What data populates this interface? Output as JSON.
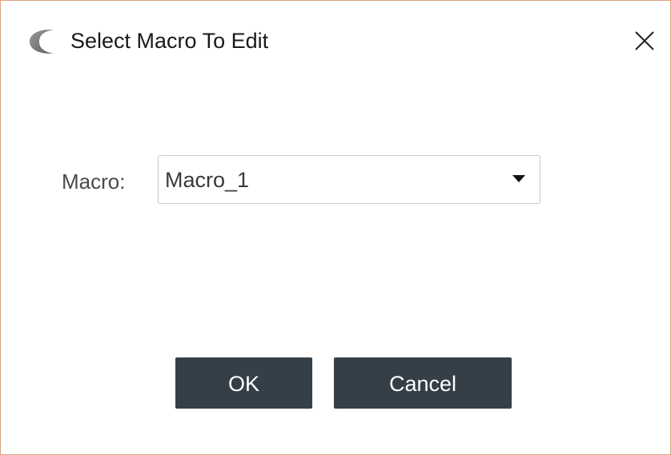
{
  "window": {
    "title": "Select Macro To Edit",
    "app_icon": "crescent-logo-icon",
    "close_icon": "close-icon"
  },
  "form": {
    "macro_label": "Macro:",
    "macro_selected": "Macro_1",
    "dropdown_icon": "dropdown-arrow-icon"
  },
  "buttons": {
    "ok_label": "OK",
    "cancel_label": "Cancel"
  },
  "colors": {
    "button_bg": "#353f47",
    "window_border": "#d9a27e"
  }
}
